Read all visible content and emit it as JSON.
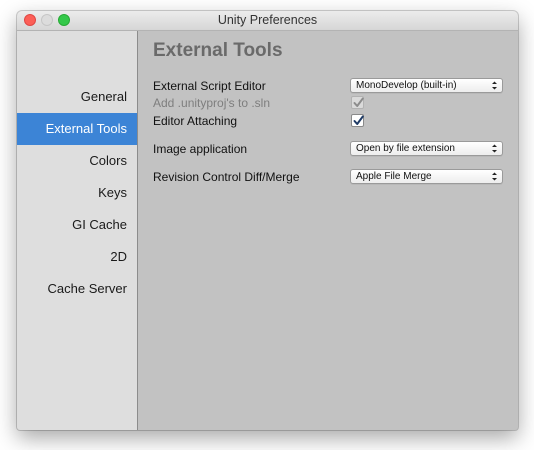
{
  "window": {
    "title": "Unity Preferences"
  },
  "sidebar": {
    "items": [
      {
        "label": "General",
        "active": false
      },
      {
        "label": "External Tools",
        "active": true
      },
      {
        "label": "Colors",
        "active": false
      },
      {
        "label": "Keys",
        "active": false
      },
      {
        "label": "GI Cache",
        "active": false
      },
      {
        "label": "2D",
        "active": false
      },
      {
        "label": "Cache Server",
        "active": false
      }
    ]
  },
  "main": {
    "section_title": "External Tools",
    "external_script_editor": {
      "label": "External Script Editor",
      "value": "MonoDevelop (built-in)"
    },
    "add_unityproj": {
      "label": "Add .unityproj's to .sln",
      "checked": true,
      "enabled": false
    },
    "editor_attaching": {
      "label": "Editor Attaching",
      "checked": true
    },
    "image_application": {
      "label": "Image application",
      "value": "Open by file extension"
    },
    "revision_control": {
      "label": "Revision Control Diff/Merge",
      "value": "Apple File Merge"
    }
  },
  "colors": {
    "accent": "#3c84d6",
    "sidebar_bg": "#dedede",
    "content_bg": "#c2c2c2"
  },
  "icons": {
    "close": "close-button-icon",
    "minimize": "minimize-button-icon",
    "zoom": "zoom-button-icon",
    "checkmark": "checkmark-icon",
    "dropdown_arrows": "chevron-up-down-icon"
  }
}
